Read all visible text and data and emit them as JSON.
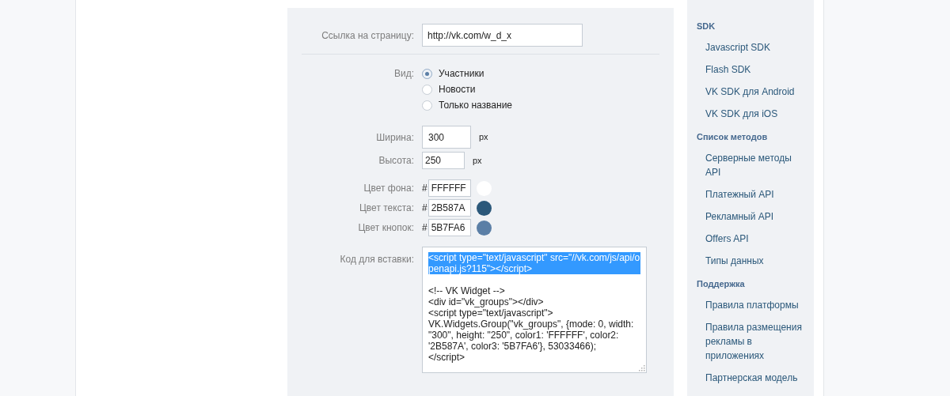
{
  "form": {
    "page_link": {
      "label": "Ссылка на страницу:",
      "value": "http://vk.com/w_d_x"
    },
    "view": {
      "label": "Вид:",
      "options": [
        {
          "label": "Участники",
          "selected": true
        },
        {
          "label": "Новости",
          "selected": false
        },
        {
          "label": "Только название",
          "selected": false
        }
      ]
    },
    "width": {
      "label": "Ширина:",
      "value": "300",
      "unit": "px"
    },
    "height": {
      "label": "Высота:",
      "value": "250",
      "unit": "px"
    },
    "colors": [
      {
        "label": "Цвет фона:",
        "hash": "#",
        "value": "FFFFFF",
        "color": "#ffffff"
      },
      {
        "label": "Цвет текста:",
        "hash": "#",
        "value": "2B587A",
        "color": "#2b587a"
      },
      {
        "label": "Цвет кнопок:",
        "hash": "#",
        "value": "5B7FA6",
        "color": "#5b7fa6"
      }
    ],
    "embed_code": {
      "label": "Код для вставки:",
      "selected_text": "<script type=\"text/javascript\" src=\"//vk.com/js/api/openapi.js?115\"></script>",
      "text": "<!-- VK Widget -->\n<div id=\"vk_groups\"></div>\n<script type=\"text/javascript\">\nVK.Widgets.Group(\"vk_groups\", {mode: 0, width: \"300\", height: \"250\", color1: 'FFFFFF', color2: '2B587A', color3: '5B7FA6'}, 53033466);\n</script>"
    }
  },
  "sidebar": {
    "sections": [
      {
        "title": "SDK",
        "items": [
          "Javascript SDK",
          "Flash SDK",
          "VK SDK для Android",
          "VK SDK для iOS"
        ]
      },
      {
        "title": "Список методов",
        "items": [
          "Серверные методы API",
          "Платежный API",
          "Рекламный API",
          "Offers API",
          "Типы данных"
        ]
      },
      {
        "title": "Поддержка",
        "items": [
          "Правила платформы",
          "Правила размещения рекламы в приложениях",
          "Партнерская модель"
        ]
      }
    ]
  }
}
